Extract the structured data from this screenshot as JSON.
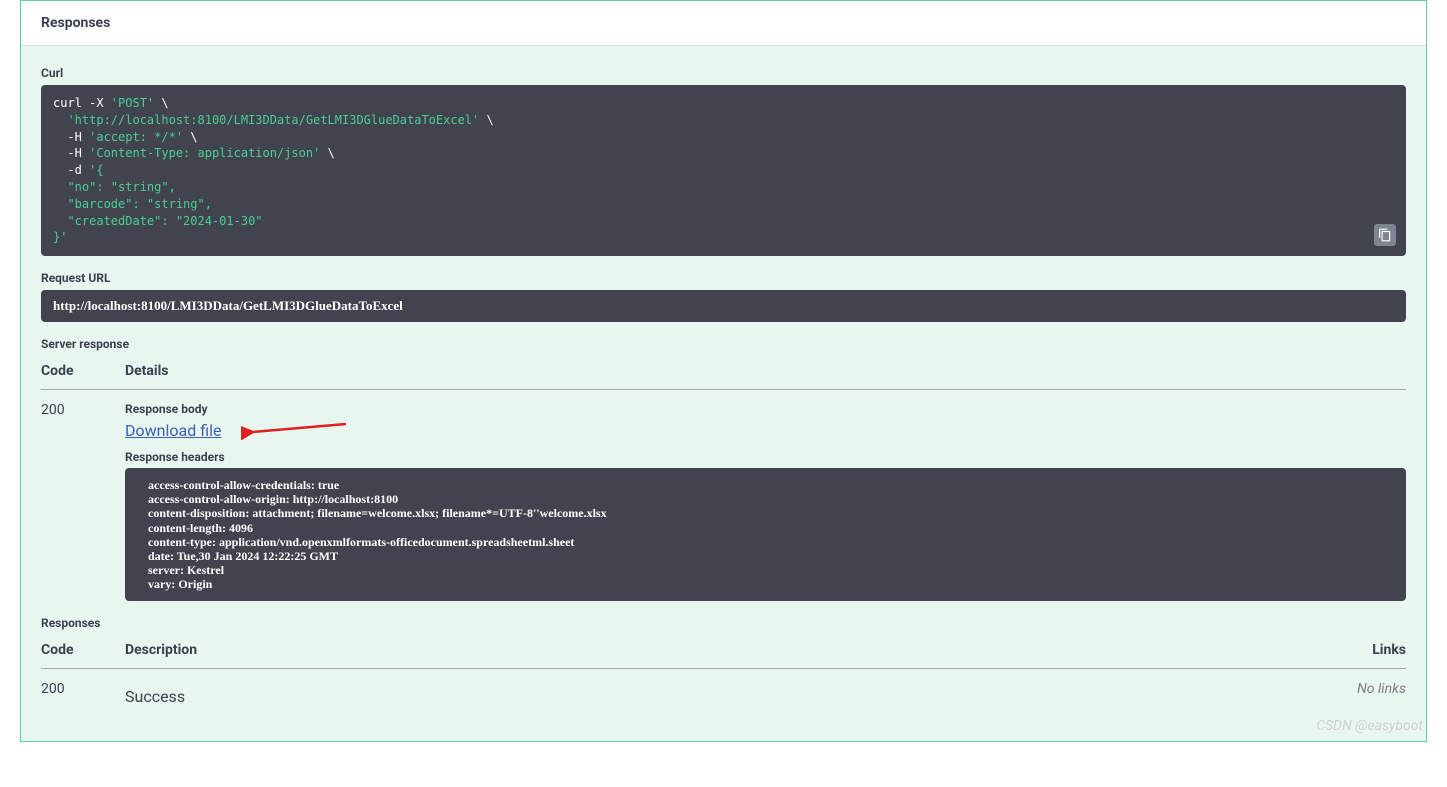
{
  "responsesTitle": "Responses",
  "curlLabel": "Curl",
  "curlCommand": {
    "line1_a": "curl -X ",
    "line1_b": "'POST'",
    "line1_c": " \\",
    "line2_a": "  ",
    "line2_b": "'http://localhost:8100/LMI3DData/GetLMI3DGlueDataToExcel'",
    "line2_c": " \\",
    "line3_a": "  -H ",
    "line3_b": "'accept: */*'",
    "line3_c": " \\",
    "line4_a": "  -H ",
    "line4_b": "'Content-Type: application/json'",
    "line4_c": " \\",
    "line5_a": "  -d ",
    "line5_b": "'{",
    "line6": "  \"no\": \"string\",",
    "line7": "  \"barcode\": \"string\",",
    "line8": "  \"createdDate\": \"2024-01-30\"",
    "line9": "}'"
  },
  "requestUrlLabel": "Request URL",
  "requestUrl": "http://localhost:8100/LMI3DData/GetLMI3DGlueDataToExcel",
  "serverResponseLabel": "Server response",
  "codeHeader": "Code",
  "detailsHeader": "Details",
  "descriptionHeader": "Description",
  "linksHeader": "Links",
  "code200": "200",
  "responseBodyLabel": "Response body",
  "downloadFileText": "Download file",
  "responseHeadersLabel": "Response headers",
  "responseHeaders": " access-control-allow-credentials: true \n access-control-allow-origin: http://localhost:8100 \n content-disposition: attachment; filename=welcome.xlsx; filename*=UTF-8''welcome.xlsx \n content-length: 4096 \n content-type: application/vnd.openxmlformats-officedocument.spreadsheetml.sheet \n date: Tue,30 Jan 2024 12:22:25 GMT \n server: Kestrel \n vary: Origin ",
  "responsesSubLabel": "Responses",
  "successText": "Success",
  "noLinksText": "No links",
  "watermark": "CSDN @easyboot"
}
